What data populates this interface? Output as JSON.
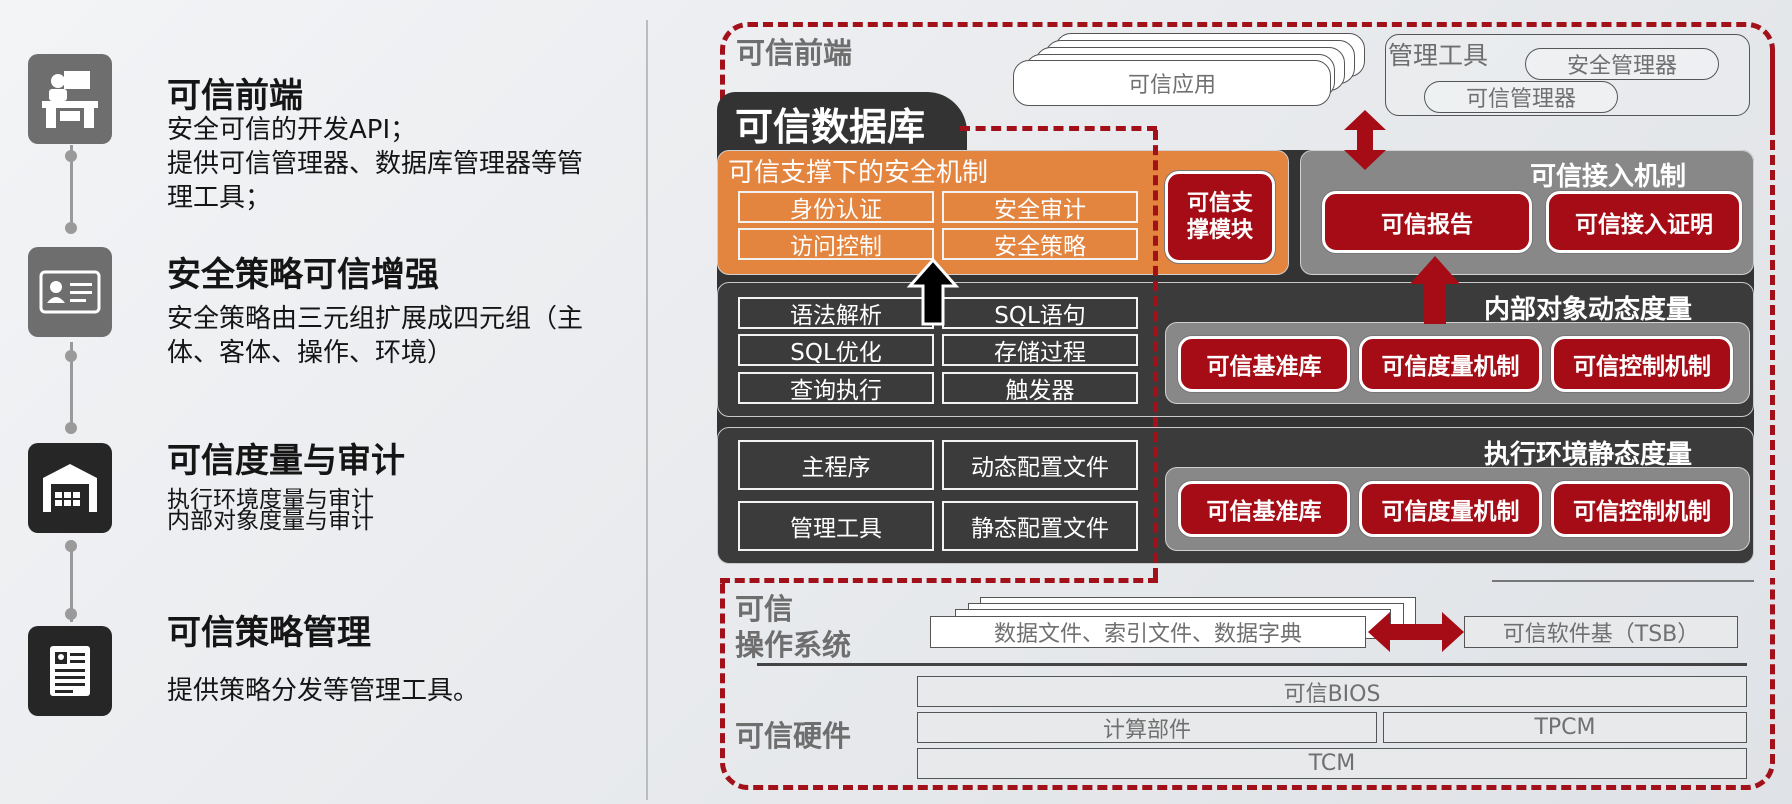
{
  "features": [
    {
      "title": "可信前端",
      "desc": [
        "安全可信的开发API；",
        "提供可信管理器、数据库管理器等管",
        "理工具；"
      ],
      "icon": "desk-user-icon"
    },
    {
      "title": "安全策略可信增强",
      "desc": [
        "安全策略由三元组扩展成四元组（主",
        "体、客体、操作、环境）"
      ],
      "icon": "id-card-icon"
    },
    {
      "title": "可信度量与审计",
      "desc": [
        "执行环境度量与审计",
        "内部对象度量与审计"
      ],
      "icon": "warehouse-icon"
    },
    {
      "title": "可信策略管理",
      "desc": [
        "提供策略分发等管理工具。"
      ],
      "icon": "document-form-icon"
    }
  ],
  "diagram": {
    "frontend_label": "可信前端",
    "trusted_app": "可信应用",
    "mgmt_tools": {
      "label": "管理工具",
      "security_manager": "安全管理器",
      "trusted_manager": "可信管理器"
    },
    "database_label": "可信数据库",
    "security_mech": {
      "title": "可信支撑下的安全机制",
      "cells": [
        "身份认证",
        "安全审计",
        "访问控制",
        "安全策略"
      ]
    },
    "support_module": "可信支撑模块",
    "access_mech": {
      "title": "可信接入机制",
      "report": "可信报告",
      "proof": "可信接入证明"
    },
    "engine_cells": [
      "语法解析",
      "SQL语句",
      "SQL优化",
      "存储过程",
      "查询执行",
      "触发器"
    ],
    "dynamic": {
      "title": "内部对象动态度量",
      "items": [
        "可信基准库",
        "可信度量机制",
        "可信控制机制"
      ]
    },
    "program_cells": [
      "主程序",
      "动态配置文件",
      "管理工具",
      "静态配置文件"
    ],
    "static": {
      "title": "执行环境静态度量",
      "items": [
        "可信基准库",
        "可信度量机制",
        "可信控制机制"
      ]
    },
    "os_label_1": "可信",
    "os_label_2": "操作系统",
    "data_files": "数据文件、索引文件、数据字典",
    "tsb": "可信软件基（TSB）",
    "hardware_label": "可信硬件",
    "bios": "可信BIOS",
    "compute": "计算部件",
    "tpcm": "TPCM",
    "tcm": "TCM"
  },
  "colors": {
    "accent_red": "#a50c16",
    "orange": "#e3843f",
    "dark": "#3b3b3b",
    "grey_panel": "#888888",
    "icon_dark": "#262626",
    "icon_grey": "#6e6e6e"
  }
}
